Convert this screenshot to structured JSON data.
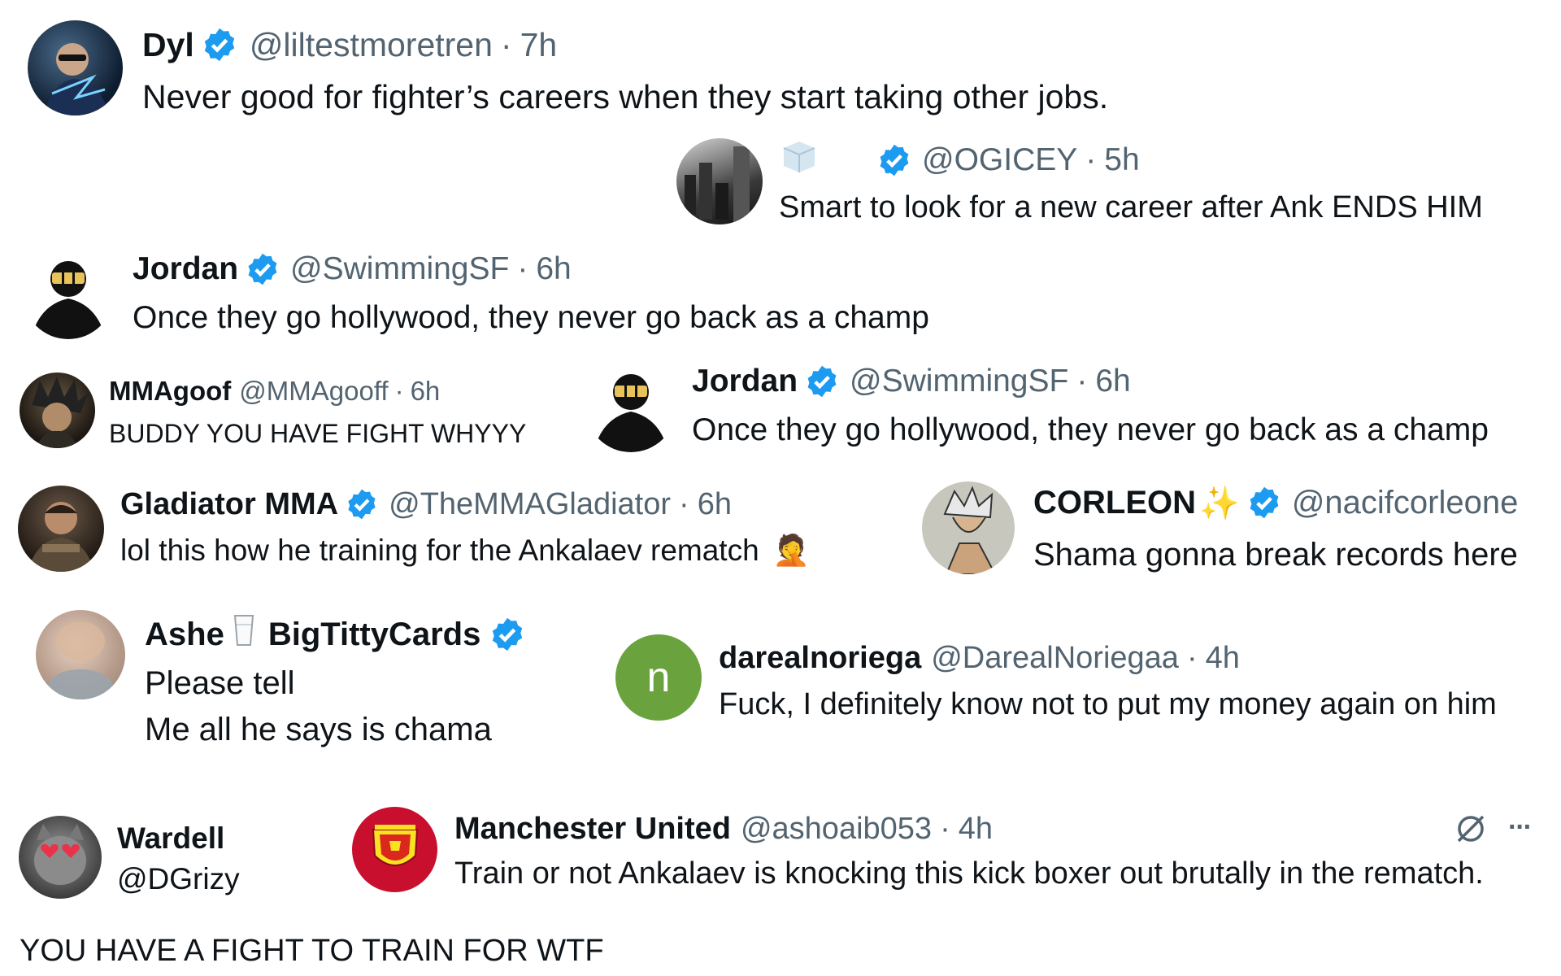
{
  "colors": {
    "verified": "#1d9bf0",
    "handle": "#536471",
    "text": "#0f1419",
    "letter_avatar": "#6aa33d",
    "manutd": "#c8102e"
  },
  "tweets": [
    {
      "name": "Dyl",
      "handle": "@liltestmoretren",
      "time": "7h",
      "sep": "·",
      "text": "Never good for fighter’s careers when they start taking other jobs.",
      "verified": true,
      "avatar_icon": "superhero-avatar-icon"
    },
    {
      "name": "",
      "handle": "@OGICEY",
      "time": "5h",
      "sep": "·",
      "text": "Smart to look for a new career after Ank ENDS HIM",
      "verified": true,
      "avatar_icon": "city-avatar-icon",
      "name_icon": "ice-cube-icon"
    },
    {
      "name": "Jordan",
      "handle": "@SwimmingSF",
      "time": "6h",
      "sep": "·",
      "text": "Once they go hollywood, they never go back as a champ",
      "verified": true,
      "avatar_icon": "masked-figure-avatar-icon"
    },
    {
      "name": "MMAgoof",
      "handle": "@MMAgooff",
      "time": "6h",
      "sep": "·",
      "text": "BUDDY YOU HAVE FIGHT WHYYY",
      "verified": false,
      "avatar_icon": "anime-character-avatar-icon"
    },
    {
      "name": "Jordan",
      "handle": "@SwimmingSF",
      "time": "6h",
      "sep": "·",
      "text": "Once they go hollywood, they never go back as a champ",
      "verified": true,
      "avatar_icon": "masked-figure-avatar-icon"
    },
    {
      "name": "Gladiator MMA",
      "handle": "@TheMMAGladiator",
      "time": "6h",
      "sep": "·",
      "text": "lol this how he training for the Ankalaev rematch",
      "emoji": "🤦",
      "verified": true,
      "avatar_icon": "gladiator-avatar-icon"
    },
    {
      "name": "CORLEON",
      "name_emoji": "✨",
      "handle": "@nacifcorleone",
      "text": "Shama gonna break records here",
      "verified": true,
      "avatar_icon": "anime-sketch-avatar-icon"
    },
    {
      "name": "Ashe",
      "name_icon": "milk-glass-icon",
      "name2": "BigTittyCards",
      "text_lines": [
        "Please tell",
        "Me all he says is chama"
      ],
      "verified": true,
      "avatar_icon": "blurred-person-avatar-icon"
    },
    {
      "name": "darealnoriega",
      "handle": "@DarealNoriegaa",
      "time": "4h",
      "sep": "·",
      "text": "Fuck, I definitely know not to put my money again on him",
      "verified": false,
      "avatar_letter": "n"
    },
    {
      "name": "Wardell",
      "handle": "@DGrizy",
      "text": "YOU HAVE A FIGHT TO TRAIN FOR WTF",
      "verified": false,
      "avatar_icon": "cat-with-glasses-avatar-icon"
    },
    {
      "name": "Manchester United",
      "handle": "@ashoaib053",
      "time": "4h",
      "sep": "·",
      "text": "Train or not Ankalaev is knocking this kick boxer out brutally in the rematch.",
      "verified": false,
      "avatar_icon": "manutd-crest-avatar-icon",
      "actions": {
        "grok_icon": "grok-icon",
        "more_label": "···"
      }
    }
  ]
}
